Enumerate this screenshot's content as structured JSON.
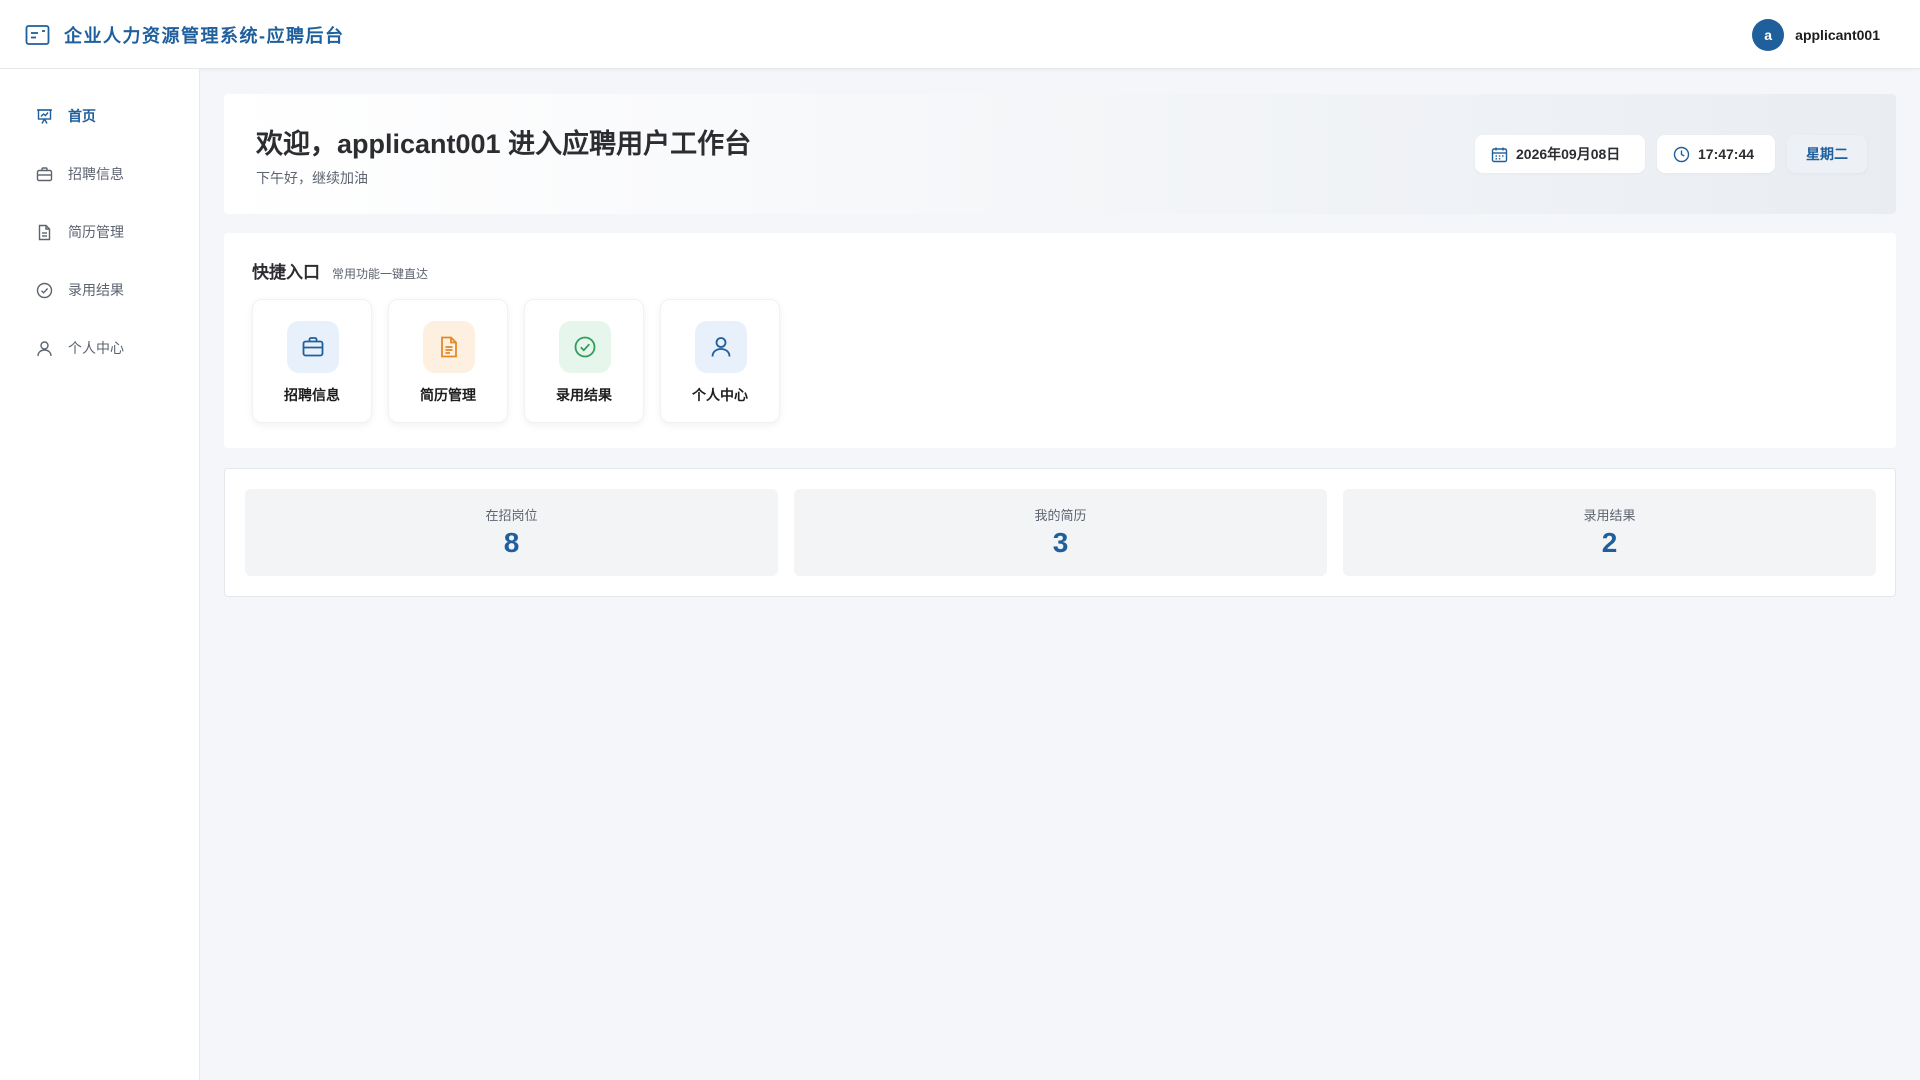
{
  "header": {
    "title": "企业人力资源管理系统-应聘后台",
    "logo_icon": "id-card-icon",
    "user": {
      "avatar_letter": "a",
      "name": "applicant001"
    }
  },
  "sidebar": {
    "items": [
      {
        "label": "首页",
        "icon": "presentation-chart-icon",
        "active": true
      },
      {
        "label": "招聘信息",
        "icon": "briefcase-icon",
        "active": false
      },
      {
        "label": "简历管理",
        "icon": "document-icon",
        "active": false
      },
      {
        "label": "录用结果",
        "icon": "check-circle-icon",
        "active": false
      },
      {
        "label": "个人中心",
        "icon": "user-icon",
        "active": false
      }
    ]
  },
  "welcome": {
    "title": "欢迎，applicant001 进入应聘用户工作台",
    "subtitle": "下午好，继续加油",
    "date": "2026年09月08日",
    "time": "17:47:44",
    "weekday": "星期二"
  },
  "quick": {
    "title": "快捷入口",
    "subtitle": "常用功能一键直达",
    "items": [
      {
        "label": "招聘信息",
        "icon": "briefcase-icon",
        "tint": "#e8f1fb",
        "color": "#1f5f9c"
      },
      {
        "label": "简历管理",
        "icon": "document-icon",
        "tint": "#fdf0e1",
        "color": "#e08a2b"
      },
      {
        "label": "录用结果",
        "icon": "check-circle-icon",
        "tint": "#e6f6ec",
        "color": "#2f9e58"
      },
      {
        "label": "个人中心",
        "icon": "user-icon",
        "tint": "#e8f1fb",
        "color": "#1f5f9c"
      }
    ]
  },
  "stats": [
    {
      "label": "在招岗位",
      "value": "8"
    },
    {
      "label": "我的简历",
      "value": "3"
    },
    {
      "label": "录用结果",
      "value": "2"
    }
  ],
  "colors": {
    "primary": "#1f5f9c",
    "background": "#f4f6f9"
  }
}
